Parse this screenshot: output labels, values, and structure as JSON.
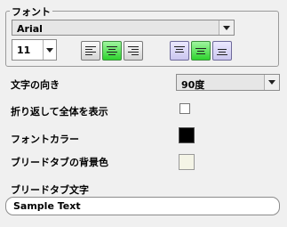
{
  "font_group": {
    "legend": "フォント",
    "font_name": "Arial",
    "font_size": "11"
  },
  "horizontal_align": {
    "buttons": [
      "align-left",
      "align-center",
      "align-right"
    ],
    "selected": "align-center"
  },
  "vertical_align": {
    "buttons": [
      "align-top",
      "align-middle",
      "align-bottom"
    ],
    "selected": "align-middle"
  },
  "text_direction": {
    "label": "文字の向き",
    "value": "90度"
  },
  "wrap_text": {
    "label": "折り返して全体を表示",
    "checked": false
  },
  "font_color": {
    "label": "フォントカラー",
    "color": "#000000"
  },
  "bleed_bg": {
    "label": "ブリードタブの背景色",
    "color": "#f4f4e6"
  },
  "bleed_text": {
    "label": "ブリードタブ文字",
    "value": "Sample Text"
  }
}
